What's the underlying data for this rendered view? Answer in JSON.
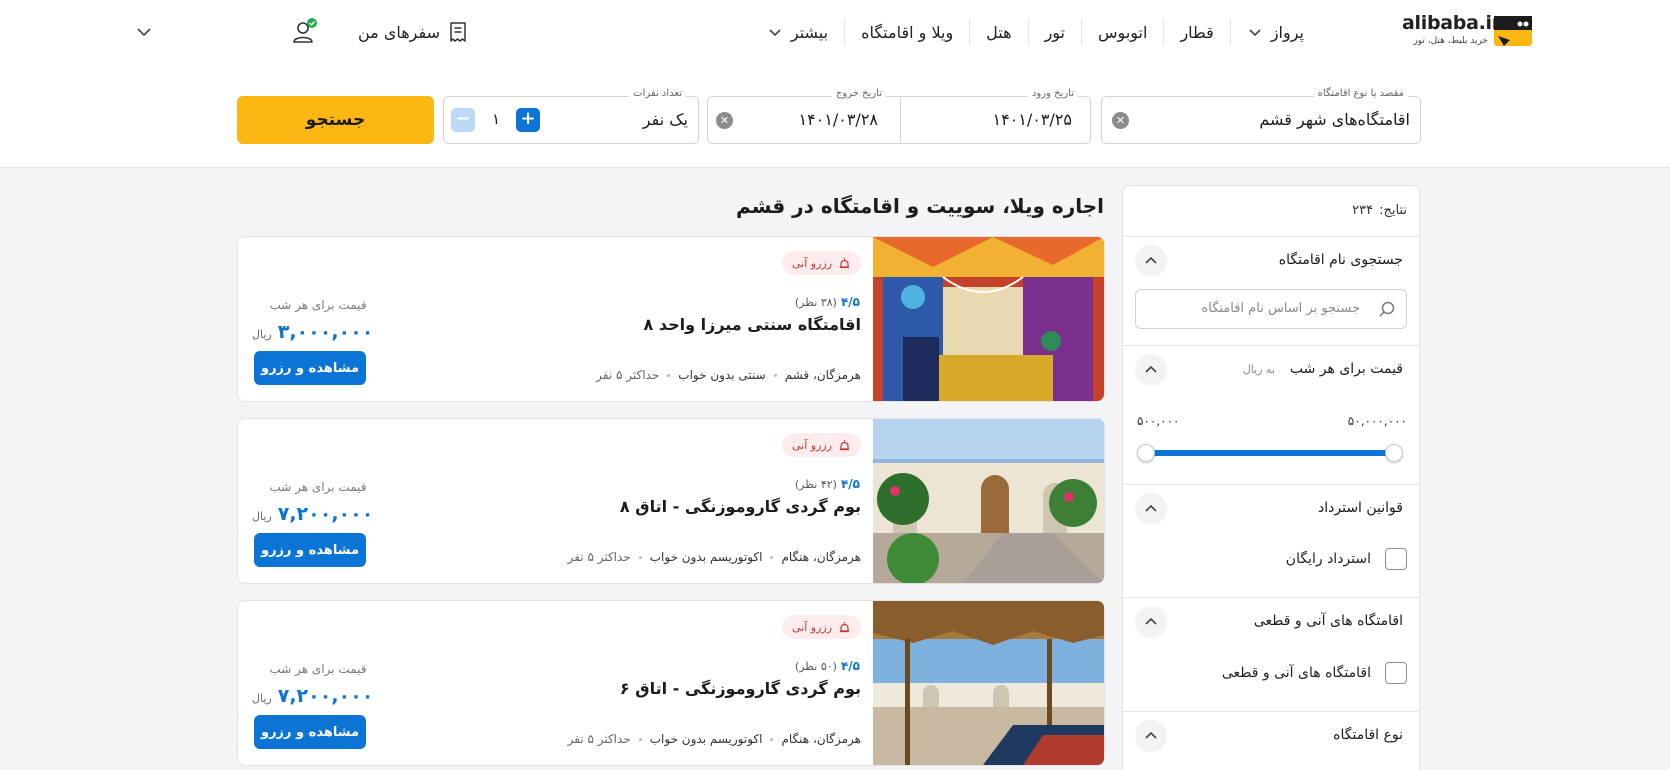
{
  "header": {
    "logo": {
      "brand": "alibaba.ir",
      "tagline": "خرید بلیط، هتل، تور"
    },
    "nav": [
      {
        "label": "پرواز",
        "has_dropdown": true
      },
      {
        "label": "قطار"
      },
      {
        "label": "اتوبوس"
      },
      {
        "label": "تور"
      },
      {
        "label": "هتل"
      },
      {
        "label": "ویلا و اقامتگاه"
      },
      {
        "label": "بیشتر",
        "has_dropdown": true
      }
    ],
    "my_trips": "سفرهای من"
  },
  "search": {
    "destination": {
      "label": "مقصد یا نوع اقامتگاه",
      "value": "اقامتگاه‌های شهر قشم"
    },
    "checkin": {
      "label": "تاریخ ورود",
      "value": "۱۴۰۱/۰۳/۲۵"
    },
    "checkout": {
      "label": "تاریخ خروج",
      "value": "۱۴۰۱/۰۳/۲۸"
    },
    "guests": {
      "label": "تعداد نفرات",
      "value": "یک نفر",
      "count": "۱"
    },
    "submit": "جستجو"
  },
  "filters": {
    "results_label": "نتایج:",
    "results_count": "۲۳۴",
    "name_search": {
      "title": "جستجوی نام اقامتگاه",
      "placeholder": "جستجو بر اساس نام اقامتگاه"
    },
    "price": {
      "title": "قیمت برای هر شب",
      "unit": "به ریال",
      "max": "۵۰,۰۰۰,۰۰۰",
      "min": "۵۰۰,۰۰۰"
    },
    "refund": {
      "title": "قوانین استرداد",
      "option": "استرداد رایگان"
    },
    "instant": {
      "title": "اقامتگاه های آنی و قطعی",
      "option": "اقامتگاه های آنی و قطعی"
    },
    "type": {
      "title": "نوع اقامتگاه"
    }
  },
  "results": {
    "title": "اجاره ویلا، سوییت و اقامتگاه در قشم",
    "price_label": "قیمت برای هر شب",
    "currency": "ریال",
    "book_label": "مشاهده و رزرو",
    "listings": [
      {
        "badge": "رزرو آنی",
        "score": "۴/۵",
        "reviews": "(۳۸ نظر)",
        "name": "اقامتگاه سنتی میرزا واحد ۸",
        "location": "هرمزگان، قشم",
        "style": "سنتی بدون خواب",
        "capacity": "حداکثر ۵ نفر",
        "price": "۳,۰۰۰,۰۰۰"
      },
      {
        "badge": "رزرو آنی",
        "score": "۴/۵",
        "reviews": "(۴۲ نظر)",
        "name": "بوم گردی گاروموزنگی - اتاق ۸",
        "location": "هرمزگان، هنگام",
        "style": "اکوتوریسم بدون خواب",
        "capacity": "حداکثر ۵ نفر",
        "price": "۷,۲۰۰,۰۰۰"
      },
      {
        "badge": "رزرو آنی",
        "score": "۴/۵",
        "reviews": "(۵۰ نظر)",
        "name": "بوم گردی گاروموزنگی - اتاق ۶",
        "location": "هرمزگان، هنگام",
        "style": "اکوتوریسم بدون خواب",
        "capacity": "حداکثر ۵ نفر",
        "price": "۷,۲۰۰,۰۰۰"
      }
    ]
  },
  "colors": {
    "accent_blue": "#0b74d4",
    "accent_yellow": "#fdb713",
    "badge_bg": "#fdecee",
    "badge_fg": "#c0392b"
  }
}
